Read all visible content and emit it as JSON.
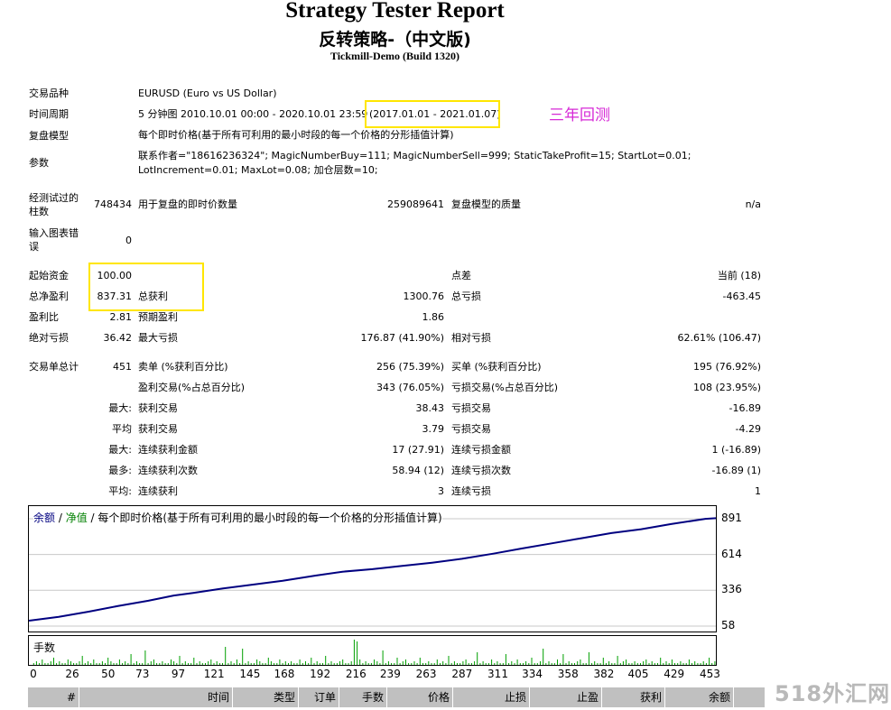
{
  "header": {
    "title": "Strategy Tester Report",
    "subtitle": "反转策略-（中文版)",
    "server": "Tickmill-Demo (Build 1320)"
  },
  "annotation": "三年回测",
  "info": {
    "symbol_label": "交易品种",
    "symbol_value": "EURUSD (Euro vs US Dollar)",
    "period_label": "时间周期",
    "period_value": "5 分钟图 2010.10.01 00:00 - 2020.10.01 23:59",
    "period_range": "(2017.01.01 - 2021.01.07)",
    "model_label": "复盘模型",
    "model_value": "每个即时价格(基于所有可利用的最小时段的每一个价格的分形插值计算)",
    "params_label": "参数",
    "params_line1": "联系作者=\"18616236324\"; MagicNumberBuy=111; MagicNumberSell=999; StaticTakeProfit=15; StartLot=0.01;",
    "params_line2": "LotIncrement=0.01; MaxLot=0.08; 加仓层数=10;"
  },
  "bars": {
    "label_line1": "经测试过的",
    "label_line2": "柱数",
    "value": "748434",
    "ticks_label": "用于复盘的即时价数量",
    "ticks_value": "259089641",
    "quality_label": "复盘模型的质量",
    "quality_value": "n/a",
    "errors_label_line1": "输入图表错",
    "errors_label_line2": "误",
    "errors_value": "0"
  },
  "stats": {
    "initial_deposit_label": "起始资金",
    "initial_deposit": "100.00",
    "spread_label": "点差",
    "spread_value": "当前 (18)",
    "net_profit_label": "总净盈利",
    "net_profit": "837.31",
    "gross_profit_label": "总获利",
    "gross_profit": "1300.76",
    "gross_loss_label": "总亏损",
    "gross_loss": "-463.45",
    "profit_factor_label": "盈利比",
    "profit_factor": "2.81",
    "expected_payoff_label": "预期盈利",
    "expected_payoff": "1.86",
    "abs_drawdown_label": "绝对亏损",
    "abs_drawdown": "36.42",
    "max_drawdown_label": "最大亏损",
    "max_drawdown": "176.87 (41.90%)",
    "rel_drawdown_label": "相对亏损",
    "rel_drawdown": "62.61% (106.47)"
  },
  "trades": {
    "total_label": "交易单总计",
    "total": "451",
    "short_label": "卖单 (%获利百分比)",
    "short_value": "256 (75.39%)",
    "long_label": "买单 (%获利百分比)",
    "long_value": "195 (76.92%)",
    "profit_trades_label": "盈利交易(%占总百分比)",
    "profit_trades_value": "343 (76.05%)",
    "loss_trades_label": "亏损交易(%占总百分比)",
    "loss_trades_value": "108 (23.95%)",
    "largest_prefix": "最大:",
    "largest_profit_label": "获利交易",
    "largest_profit": "38.43",
    "largest_loss_label": "亏损交易",
    "largest_loss": "-16.89",
    "average_prefix": "平均",
    "avg_profit_label": "获利交易",
    "avg_profit": "3.79",
    "avg_loss_label": "亏损交易",
    "avg_loss": "-4.29",
    "max_consec_prefix": "最大:",
    "max_consec_wins_amt_label": "连续获利金额",
    "max_consec_wins_amt": "17 (27.91)",
    "max_consec_loss_amt_label": "连续亏损金额",
    "max_consec_loss_amt": "1 (-16.89)",
    "most_prefix": "最多:",
    "max_consec_profit_count_label": "连续获利次数",
    "max_consec_profit_count": "58.94 (12)",
    "max_consec_loss_count_label": "连续亏损次数",
    "max_consec_loss_count": "-16.89 (1)",
    "avg_prefix": "平均:",
    "avg_consec_wins_label": "连续获利",
    "avg_consec_wins": "3",
    "avg_consec_losses_label": "连续亏损",
    "avg_consec_losses": "1"
  },
  "chart_title": {
    "balance": "余额",
    "sep1": " / ",
    "equity": "净值",
    "rest": " / 每个即时价格(基于所有可利用的最小时段的每一个价格的分形插值计算)"
  },
  "volume_label": "手数",
  "chart_data": {
    "type": "line",
    "x_ticks": [
      "0",
      "26",
      "50",
      "73",
      "97",
      "121",
      "145",
      "168",
      "192",
      "216",
      "239",
      "263",
      "287",
      "311",
      "334",
      "358",
      "382",
      "405",
      "429",
      "453"
    ],
    "y_ticks": [
      "891",
      "614",
      "336",
      "58"
    ],
    "ylim": [
      58,
      891
    ],
    "xlim": [
      0,
      460
    ],
    "series": [
      {
        "name": "余额",
        "color": "#000080",
        "x": [
          0,
          20,
          40,
          60,
          80,
          97,
          110,
          130,
          150,
          170,
          192,
          210,
          230,
          250,
          270,
          290,
          311,
          330,
          350,
          370,
          390,
          410,
          430,
          453,
          460
        ],
        "y": [
          100,
          130,
          170,
          215,
          255,
          295,
          315,
          350,
          380,
          410,
          450,
          480,
          500,
          525,
          550,
          580,
          620,
          660,
          700,
          740,
          780,
          810,
          850,
          890,
          895
        ]
      }
    ],
    "volume": [
      0,
      1,
      2,
      1,
      3,
      1,
      1,
      2,
      4,
      1,
      2,
      1,
      1,
      3,
      2,
      1,
      1,
      2,
      5,
      1,
      2,
      1,
      3,
      1,
      1,
      2,
      1,
      4,
      2,
      1,
      1,
      3,
      1,
      2,
      1,
      6,
      1,
      2,
      1,
      1,
      8,
      1,
      2,
      3,
      1,
      1,
      2,
      1,
      1,
      3,
      2,
      1,
      5,
      1,
      2,
      1,
      1,
      4,
      1,
      2,
      1,
      1,
      2,
      3,
      1,
      2,
      1,
      1,
      10,
      1,
      2,
      1,
      3,
      1,
      9,
      1,
      2,
      1,
      1,
      3,
      2,
      1,
      1,
      4,
      2,
      1,
      1,
      3,
      1,
      2,
      1,
      2,
      1,
      1,
      3,
      1,
      2,
      1,
      4,
      1,
      2,
      1,
      1,
      5,
      1,
      2,
      1,
      1,
      2,
      3,
      1,
      1,
      2,
      14,
      13,
      3,
      1,
      2,
      1,
      1,
      3,
      2,
      1,
      8,
      1,
      2,
      1,
      1,
      4,
      1,
      2,
      3,
      1,
      1,
      2,
      1,
      4,
      1,
      1,
      2,
      1,
      1,
      3,
      1,
      2,
      1,
      5,
      1,
      2,
      1,
      1,
      2,
      3,
      1,
      1,
      2,
      7,
      1,
      2,
      1,
      1,
      3,
      1,
      2,
      1,
      1,
      6,
      1,
      2,
      1,
      3,
      1,
      1,
      2,
      1,
      4,
      1,
      1,
      2,
      9,
      1,
      2,
      1,
      1,
      3,
      1,
      6,
      1,
      2,
      1,
      1,
      2,
      3,
      1,
      1,
      7,
      1,
      2,
      1,
      1,
      4,
      1,
      2,
      1,
      1,
      5,
      1,
      2,
      3,
      1,
      1,
      2,
      1,
      1,
      2,
      3,
      1,
      2,
      1,
      1,
      4,
      1,
      2,
      1,
      3,
      1,
      1,
      2,
      1,
      1,
      3,
      1,
      2,
      1,
      1,
      2,
      1,
      4,
      1,
      2
    ]
  },
  "table_headers": [
    "#",
    "时间",
    "类型",
    "订单",
    "手数",
    "价格",
    "止损",
    "止盈",
    "获利",
    "余额"
  ],
  "watermark": "518外汇网"
}
